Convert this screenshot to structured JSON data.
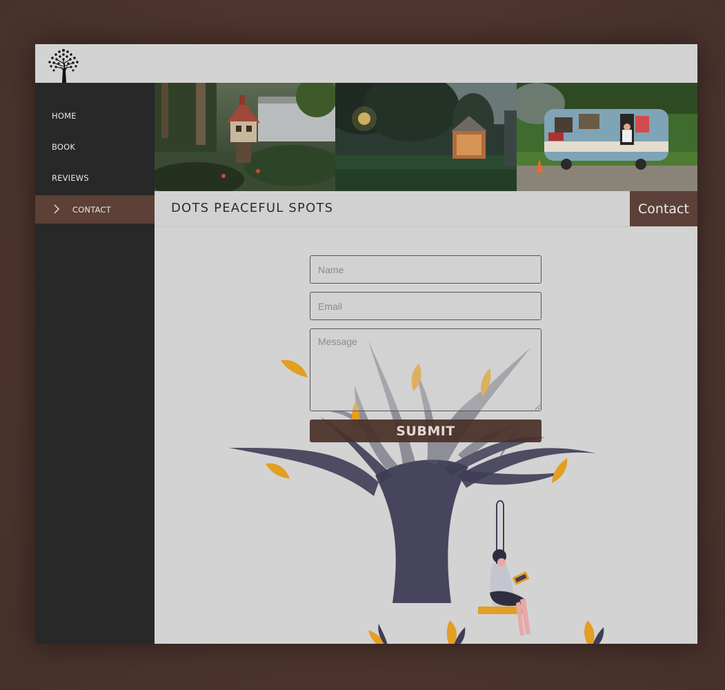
{
  "nav": {
    "items": [
      {
        "label": "HOME"
      },
      {
        "label": "BOOK"
      },
      {
        "label": "REVIEWS"
      },
      {
        "label": "CONTACT"
      }
    ]
  },
  "header": {
    "site_title": "DOTS PEACEFUL SPOTS",
    "page_label": "Contact"
  },
  "form": {
    "name_placeholder": "Name",
    "email_placeholder": "Email",
    "message_placeholder": "Message",
    "submit_label": "SUBMIT"
  },
  "colors": {
    "page_background": "#4e352e",
    "sidebar": "#282828",
    "accent": "#5d4037",
    "panel": "#d3d3d3",
    "leaf": "#e39e24",
    "trunk": "#3f3d56"
  },
  "icons": [
    "tree-logo-icon",
    "chevron-right-icon"
  ]
}
